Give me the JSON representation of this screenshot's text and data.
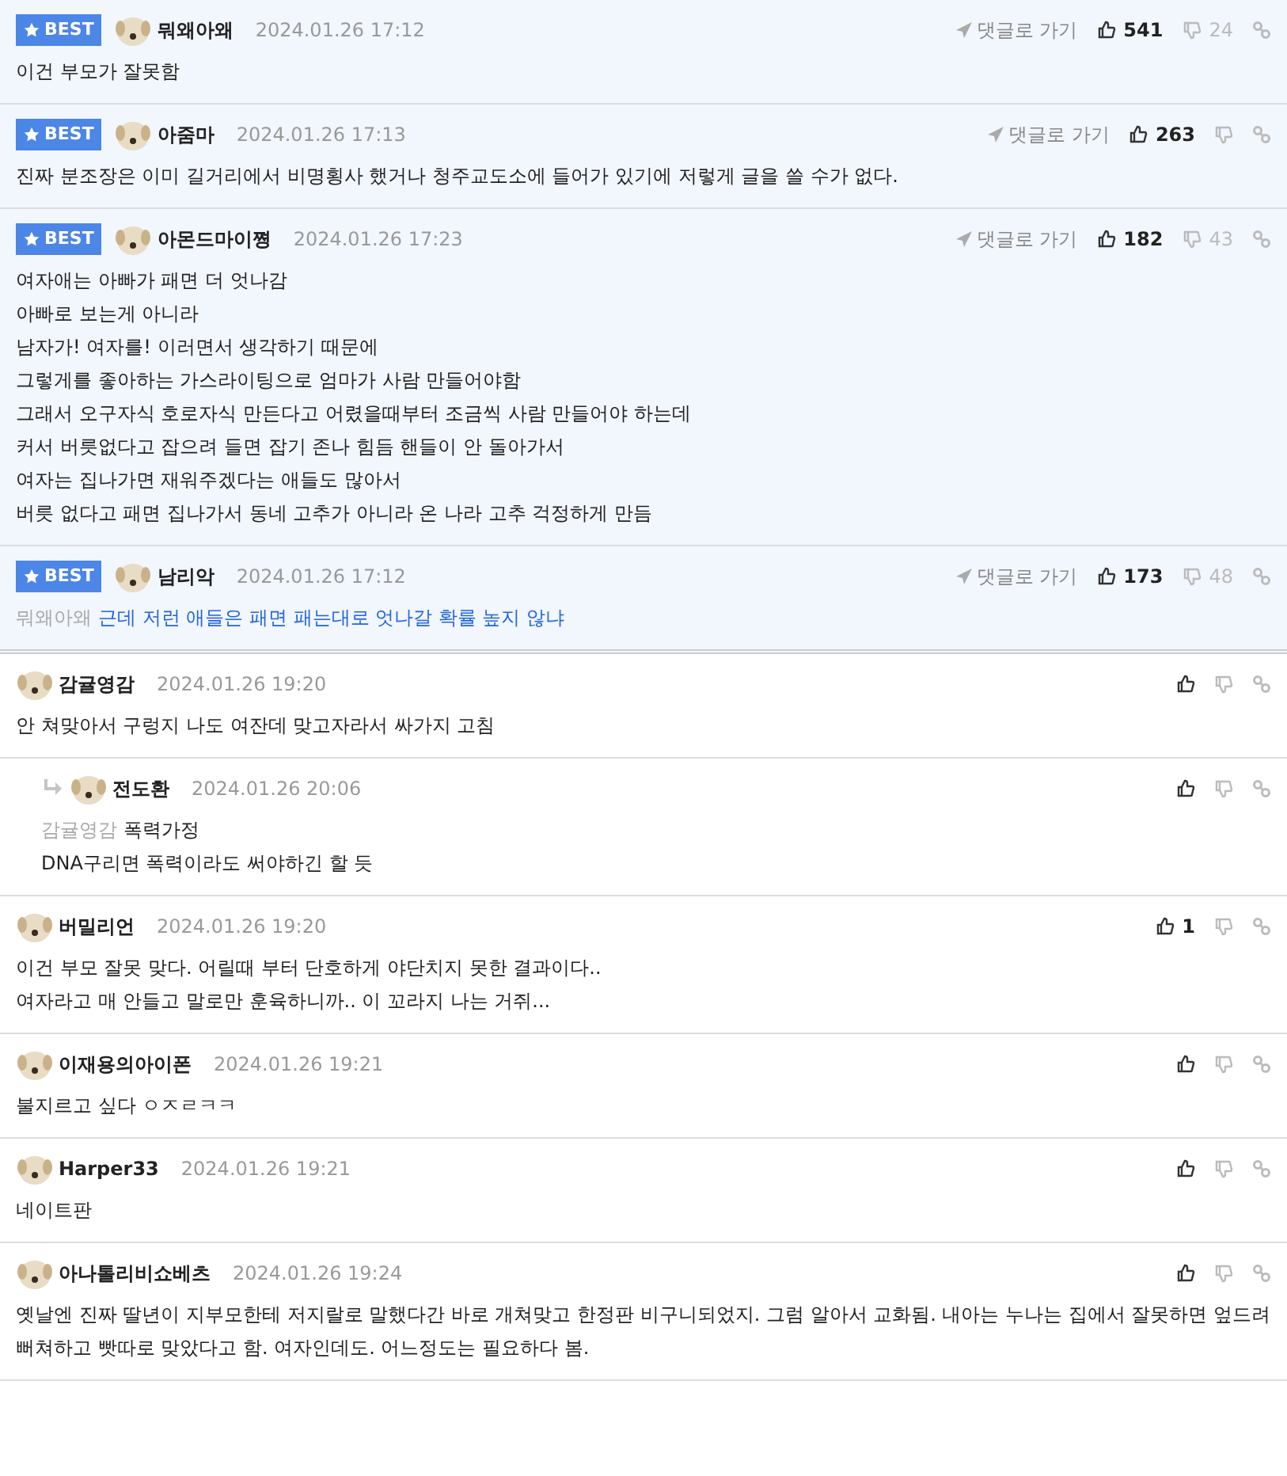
{
  "comments": [
    {
      "best": true,
      "badge": "BEST",
      "author": "뭐왜아왜",
      "date": "2024.01.26 17:12",
      "goto": "댓글로 가기",
      "likes": "541",
      "dislikes": "24",
      "lines": [
        "이건 부모가 잘못함"
      ]
    },
    {
      "best": true,
      "badge": "BEST",
      "author": "아줌마",
      "date": "2024.01.26 17:13",
      "goto": "댓글로 가기",
      "likes": "263",
      "lines": [
        "진짜 분조장은 이미 길거리에서 비명횡사 했거나 청주교도소에 들어가 있기에 저렇게 글을 쓸 수가 없다."
      ]
    },
    {
      "best": true,
      "badge": "BEST",
      "author": "아몬드마이쪙",
      "date": "2024.01.26 17:23",
      "goto": "댓글로 가기",
      "likes": "182",
      "dislikes": "43",
      "lines": [
        "여자애는 아빠가 패면 더 엇나감",
        "아빠로 보는게 아니라",
        "남자가! 여자를! 이러면서 생각하기 때문에",
        "그렇게를 좋아하는 가스라이팅으로 엄마가 사람 만들어야함",
        "그래서 오구자식 호로자식 만든다고 어렸을때부터 조금씩 사람 만들어야 하는데",
        "커서 버릇없다고 잡으려 들면 잡기 존나 힘듬 핸들이 안 돌아가서",
        "여자는 집나가면 재워주겠다는 애들도 많아서",
        "버릇 없다고 패면 집나가서 동네 고추가 아니라 온 나라 고추 걱정하게 만듬"
      ]
    },
    {
      "best": true,
      "badge": "BEST",
      "author": "남리악",
      "date": "2024.01.26 17:12",
      "goto": "댓글로 가기",
      "likes": "173",
      "dislikes": "48",
      "mention": "뭐왜아왜",
      "highlight": true,
      "lines": [
        "근데 저런 애들은 패면 패는대로 엇나갈 확률 높지 않냐"
      ]
    },
    {
      "best": false,
      "reply": false,
      "author": "감귤영감",
      "date": "2024.01.26 19:20",
      "lines": [
        "안 쳐맞아서 구렁지 나도 여잔데 맞고자라서 싸가지 고침"
      ]
    },
    {
      "best": false,
      "reply": true,
      "author": "전도환",
      "date": "2024.01.26 20:06",
      "mention": "감귤영감",
      "lines": [
        "폭력가정",
        "DNA구리면 폭력이라도 써야하긴 할 듯"
      ]
    },
    {
      "best": false,
      "reply": false,
      "author": "버밀리언",
      "date": "2024.01.26 19:20",
      "likes": "1",
      "lines": [
        "이건 부모 잘못 맞다. 어릴때 부터 단호하게 야단치지 못한 결과이다..",
        "여자라고 매 안들고 말로만 훈육하니까.. 이 꼬라지 나는 거쥐..."
      ]
    },
    {
      "best": false,
      "reply": false,
      "author": "이재용의아이폰",
      "date": "2024.01.26 19:21",
      "lines": [
        "불지르고 싶다 ㅇㅈㄹㅋㅋ"
      ]
    },
    {
      "best": false,
      "reply": false,
      "author": "Harper33",
      "date": "2024.01.26 19:21",
      "lines": [
        "네이트판"
      ]
    },
    {
      "best": false,
      "reply": false,
      "author": "아나톨리비쇼베츠",
      "date": "2024.01.26 19:24",
      "lines": [
        "옛날엔 진짜 딸년이 지부모한테 저지랄로 말했다간 바로 개쳐맞고 한정판 비구니되었지. 그럼 알아서 교화됨. 내아는 누나는 집에서 잘못하면 엎드려뻐쳐하고 빳따로 맞았다고 함. 여자인데도. 어느정도는 필요하다 봄."
      ]
    }
  ]
}
